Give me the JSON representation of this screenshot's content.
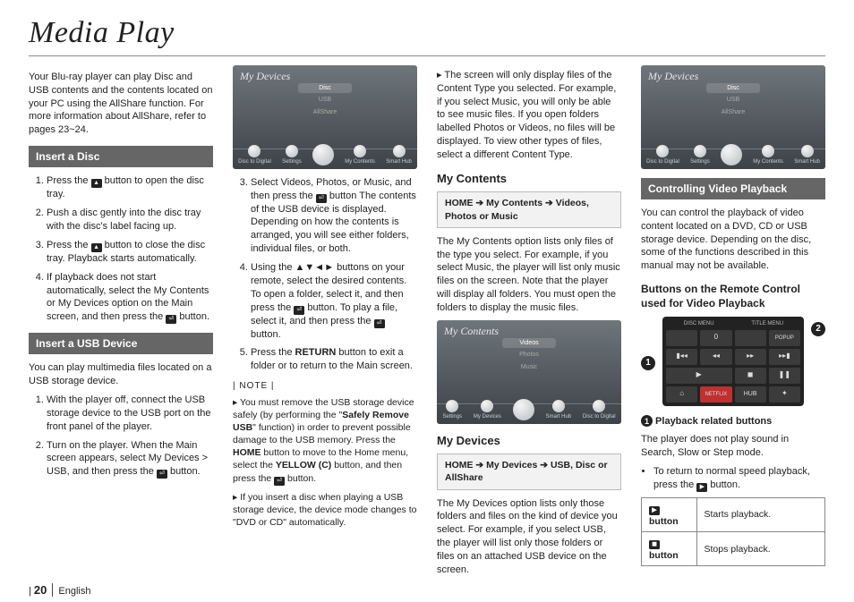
{
  "title": "Media Play",
  "intro": "Your Blu-ray player can play Disc and USB contents and the contents located on your PC using the AllShare function. For more information about AllShare, refer to pages 23~24.",
  "sec_insert_disc": "Insert a Disc",
  "disc_steps": {
    "s1a": "Press the ",
    "s1b": " button to open the disc tray.",
    "s2": "Push a disc gently into the disc tray with the disc's label facing up.",
    "s3a": "Press the ",
    "s3b": " button to close the disc tray. Playback starts automatically.",
    "s4a": "If playback does not start automatically, select the My Contents or My Devices option on the Main screen, and then press the ",
    "s4b": " button."
  },
  "sec_insert_usb": "Insert a USB Device",
  "usb_intro": "You can play multimedia files located on a USB storage device.",
  "usb_steps": {
    "s1": "With the player off, connect the USB storage device to the USB port on the front panel of the player.",
    "s2a": "Turn on the player. When the Main screen appears, select My Devices > USB, and then press the ",
    "s2b": " button."
  },
  "col2_steps": {
    "s3a": "Select Videos, Photos, or Music, and then press the ",
    "s3b": " button The contents of the USB device is displayed. Depending on how the contents is arranged, you will see either folders, individual files, or both.",
    "s4a": "Using the ▲▼◄► buttons on your remote, select the desired contents. To open a folder, select it, and then press the ",
    "s4b": " button. To play a file, select it, and then press the ",
    "s4c": " button.",
    "s5a": "Press the ",
    "s5_return": "RETURN",
    "s5b": " button to exit a folder or to return to the Main screen."
  },
  "note_label": "| NOTE |",
  "notes": {
    "n1a": "You must remove the USB storage device safely (by performing the \"",
    "n1_safe": "Safely Remove USB",
    "n1b": "\" function) in order to prevent possible damage to the USB memory. Press the ",
    "n1_home": "HOME",
    "n1c": " button to move to the Home menu, select the ",
    "n1_yellow": "YELLOW (C)",
    "n1d": " button, and then press the ",
    "n1e": " button.",
    "n2": "If you insert a disc when playing a USB storage device, the device mode changes to \"DVD or CD\" automatically."
  },
  "col3_top_note": "The screen will only display files of the Content Type you selected. For example, if you select Music, you will only be able to see music files. If you open folders labelled Photos or Videos, no files will be displayed. To view other types of files, select a different Content Type.",
  "sub_my_contents": "My Contents",
  "crumb_contents": "HOME ➔ My Contents ➔ Videos, Photos or Music",
  "my_contents_p": "The My Contents option lists only files of the type you select. For example, if you select Music, the player will list only music files on the screen. Note that the player will display all folders. You must open the folders to display the music files.",
  "sub_my_devices": "My Devices",
  "crumb_devices": "HOME ➔ My Devices ➔ USB, Disc or AllShare",
  "my_devices_p": "The My Devices option lists only those folders and files on the kind of device you select. For example, if you select USB, the player will list only those folders or files on an attached USB device on the screen.",
  "sec_video": "Controlling Video Playback",
  "video_intro": "You can control the playback of video content located on a DVD, CD or USB storage device. Depending on the disc, some of the functions described in this manual may not be available.",
  "sub_remote": "Buttons on the Remote Control used for Video Playback",
  "playback_head_a": " Playback related buttons",
  "playback_p": "The player does not play sound in Search, Slow or Step mode.",
  "playback_bullet_a": "To return to normal speed playback, press the ",
  "playback_bullet_b": " button.",
  "tbl": {
    "r1a": " button",
    "r1b": "Starts playback.",
    "r2a": " button",
    "r2b": "Stops playback."
  },
  "screen1": {
    "title": "My Devices",
    "pills": [
      "Disc",
      "USB",
      "AllShare"
    ],
    "icons": [
      "Disc to Digital",
      "Settings",
      "",
      "My Contents",
      "Smart Hub"
    ]
  },
  "screen2": {
    "title": "My Contents",
    "pills": [
      "Videos",
      "Photos",
      "Music"
    ],
    "icons": [
      "Settings",
      "My Devices",
      "",
      "Smart Hub",
      "Disc to Digital"
    ]
  },
  "remote": {
    "disc_menu": "DISC MENU",
    "title_menu": "TITLE MENU",
    "zero": "0",
    "popup": "POPUP",
    "netflix": "NETFLIX",
    "hub": "HUB"
  },
  "footer_page": "20",
  "footer_lang": "English"
}
